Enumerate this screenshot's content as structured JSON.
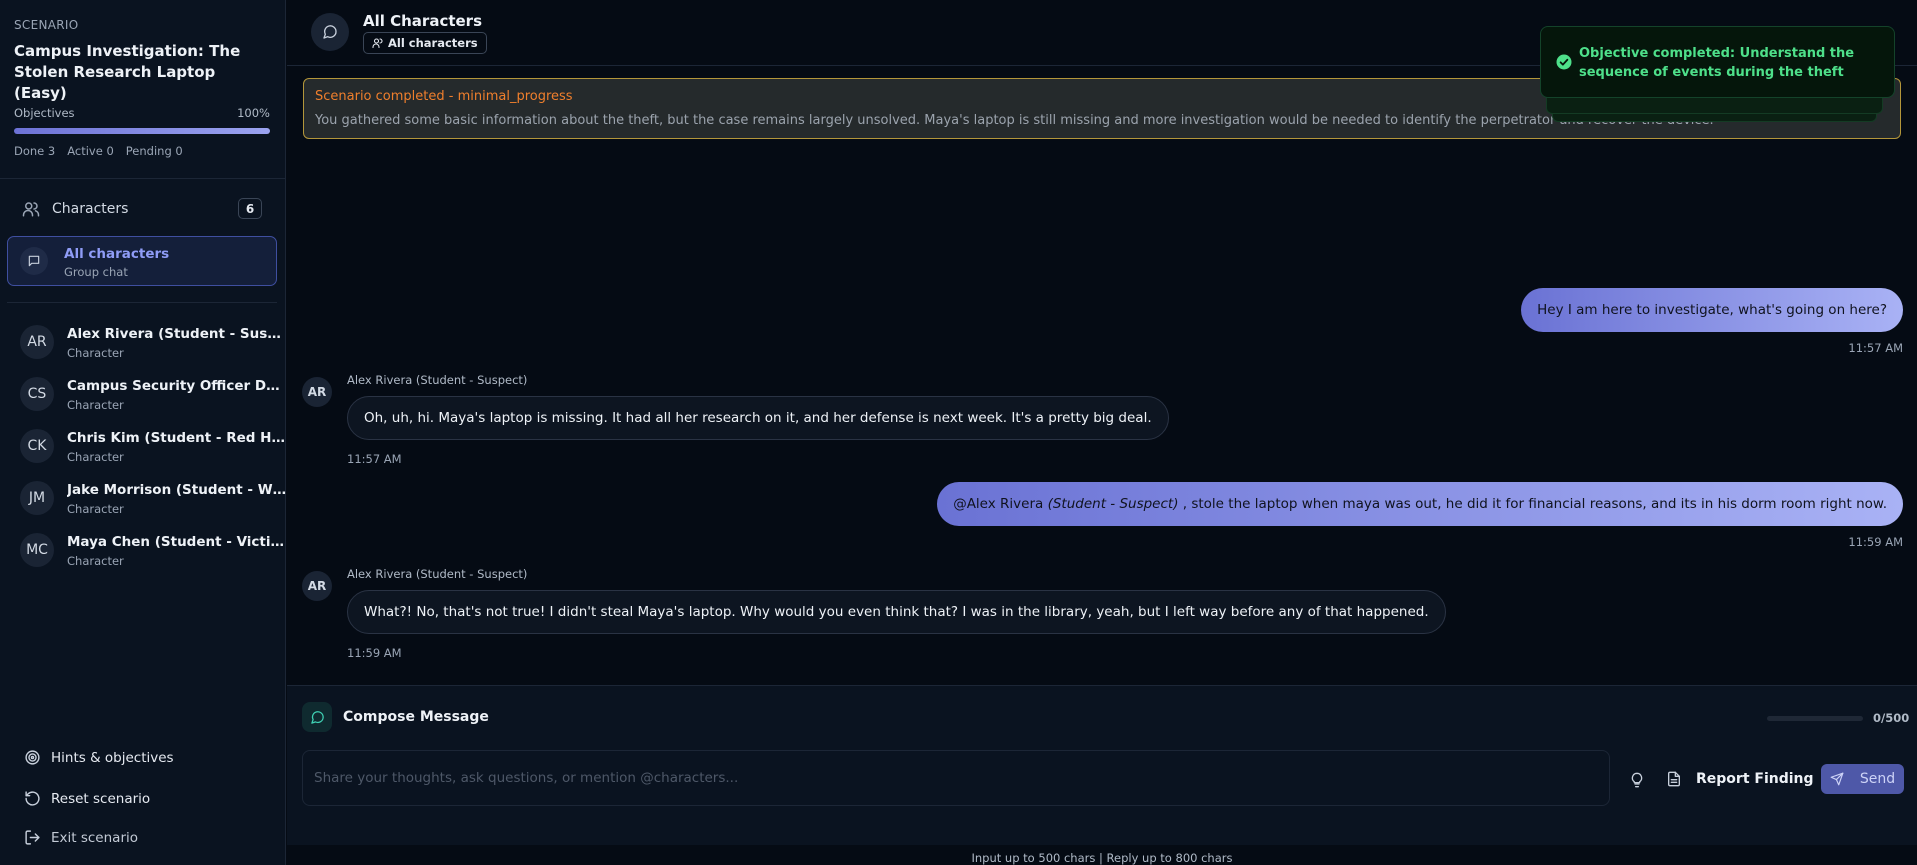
{
  "sidebar": {
    "scenario_label": "SCENARIO",
    "scenario_title": "Campus Investigation: The Stolen Research Laptop (Easy)",
    "objectives_label": "Objectives",
    "objectives_percent_text": "100%",
    "objectives_progress": 1.0,
    "stats": {
      "done": "Done 3",
      "active": "Active 0",
      "pending": "Pending 0"
    },
    "characters_label": "Characters",
    "characters_count": "6",
    "group": {
      "title": "All characters",
      "subtitle": "Group chat"
    },
    "characters": [
      {
        "initials": "AR",
        "name": "Alex Rivera (Student - Suspect)",
        "role": "Character"
      },
      {
        "initials": "CS",
        "name": "Campus Security Officer Davis",
        "role": "Character"
      },
      {
        "initials": "CK",
        "name": "Chris Kim (Student - Red Her...",
        "role": "Character"
      },
      {
        "initials": "JM",
        "name": "Jake Morrison (Student - Wit...",
        "role": "Character"
      },
      {
        "initials": "MC",
        "name": "Maya Chen (Student - Victim)",
        "role": "Character"
      }
    ],
    "bottom": {
      "hints": "Hints & objectives",
      "reset": "Reset scenario",
      "exit": "Exit scenario"
    }
  },
  "header": {
    "title": "All Characters",
    "chip": "All characters"
  },
  "banner": {
    "title": "Scenario completed - minimal_progress",
    "body": "You gathered some basic information about the theft, but the case remains largely unsolved. Maya's laptop is still missing and more investigation would be needed to identify the perpetrator and recover the device."
  },
  "messages": {
    "m1": {
      "text": "Hey I am here to investigate, what's going on here?",
      "time": "11:57 AM"
    },
    "m2": {
      "sender": "Alex Rivera (Student - Suspect)",
      "initials": "AR",
      "text": "Oh, uh, hi. Maya's laptop is missing. It had all her research on it, and her defense is next week. It's a pretty big deal.",
      "time": "11:57 AM"
    },
    "m3": {
      "mention": "@Alex Rivera",
      "mention_italic": "(Student - Suspect)",
      "text": ", stole the laptop when maya was out, he did it for financial reasons, and its in his dorm room right now.",
      "time": "11:59 AM"
    },
    "m4": {
      "sender": "Alex Rivera (Student - Suspect)",
      "initials": "AR",
      "text": "What?! No, that's not true! I didn't steal Maya's laptop. Why would you even think that? I was in the library, yeah, but I left way before any of that happened.",
      "time": "11:59 AM"
    }
  },
  "composer": {
    "title": "Compose Message",
    "count": "0/500",
    "placeholder": "Share your thoughts, ask questions, or mention @characters...",
    "report_label": "Report Finding",
    "send_label": "Send",
    "footer": "Input up to 500 chars | Reply up to 800 chars"
  },
  "toast": {
    "text": "Objective completed: Understand the sequence of events during the theft"
  },
  "colors": {
    "accent": "#8f9cf6",
    "success": "#4ee08a",
    "warning": "#f07f2c",
    "teal": "#3fd1b4"
  }
}
